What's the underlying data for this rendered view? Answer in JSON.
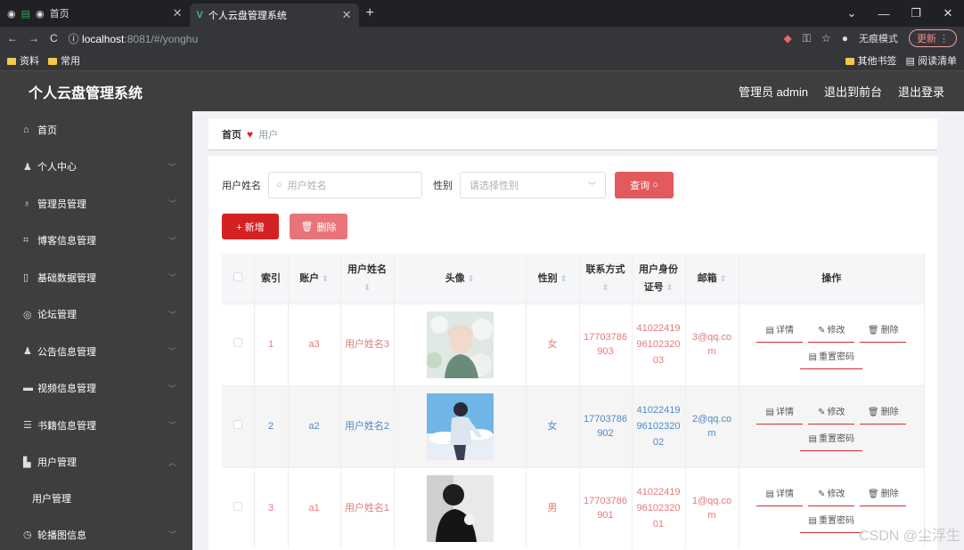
{
  "browser": {
    "tab1_label": "首页",
    "tab2_label": "个人云盘管理系统",
    "url_host": "localhost",
    "url_port_path": ":8081/#/yonghu",
    "incognito_label": "无痕模式",
    "update_label": "更新",
    "bookmarks": [
      "资料",
      "常用"
    ],
    "bookmarks_right": [
      "其他书签",
      "阅读清单"
    ]
  },
  "header": {
    "title": "个人云盘管理系统",
    "admin_label": "管理员 admin",
    "to_front": "退出到前台",
    "logout": "退出登录"
  },
  "sidebar": {
    "items": [
      {
        "label": "首页",
        "icon": "home-icon"
      },
      {
        "label": "个人中心",
        "icon": "user-icon"
      },
      {
        "label": "管理员管理",
        "icon": "mic-icon"
      },
      {
        "label": "博客信息管理",
        "icon": "crop-icon"
      },
      {
        "label": "基础数据管理",
        "icon": "phone-icon"
      },
      {
        "label": "论坛管理",
        "icon": "compass-icon"
      },
      {
        "label": "公告信息管理",
        "icon": "person-icon"
      },
      {
        "label": "视频信息管理",
        "icon": "monitor-icon"
      },
      {
        "label": "书籍信息管理",
        "icon": "list-icon"
      },
      {
        "label": "用户管理",
        "icon": "chart-icon"
      },
      {
        "label": "用户管理",
        "icon": ""
      },
      {
        "label": "轮播图信息",
        "icon": "clock-icon"
      }
    ]
  },
  "breadcrumb": {
    "home": "首页",
    "current": "用户"
  },
  "search": {
    "name_label": "用户姓名",
    "name_placeholder": "用户姓名",
    "gender_label": "性别",
    "gender_placeholder": "请选择性别",
    "query_label": "查询"
  },
  "actions": {
    "add_label": "+ 新增",
    "delete_label": "删除"
  },
  "table": {
    "headers": {
      "index": "索引",
      "account": "账户",
      "name": "用户姓名",
      "avatar": "头像",
      "gender": "性别",
      "phone": "联系方式",
      "idcard": "用户身份证号",
      "email": "邮箱",
      "ops": "操作"
    },
    "rows": [
      {
        "index": "1",
        "account": "a3",
        "name": "用户姓名3",
        "gender": "女",
        "phone": "17703786903",
        "idcard": "410224199610232003",
        "email": "3@qq.com"
      },
      {
        "index": "2",
        "account": "a2",
        "name": "用户姓名2",
        "gender": "女",
        "phone": "17703786902",
        "idcard": "410224199610232002",
        "email": "2@qq.com"
      },
      {
        "index": "3",
        "account": "a1",
        "name": "用户姓名1",
        "gender": "男",
        "phone": "17703786901",
        "idcard": "410224199610232001",
        "email": "1@qq.com"
      }
    ],
    "op_labels": {
      "detail": "详情",
      "edit": "修改",
      "delete": "删除",
      "reset": "重置密码"
    }
  },
  "watermark": "CSDN @尘浮生"
}
